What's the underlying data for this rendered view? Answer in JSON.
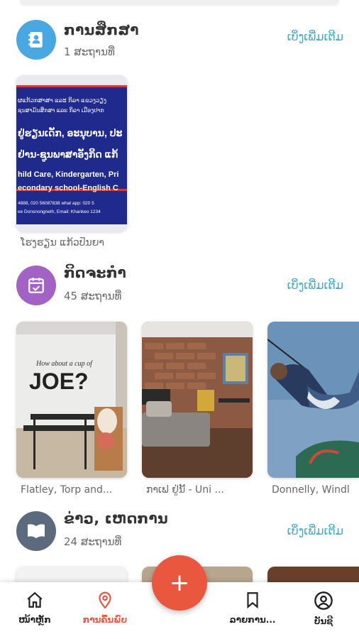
{
  "sections": [
    {
      "title": "ການສຶກສາ",
      "count": "1 ສະຖານທີ່",
      "see_more": "ເບິ່ງເພີ່ມເຕີມ",
      "icon": "contact-book-icon",
      "color": "#4aa8e0",
      "cards": [
        {
          "caption": "ໂຮງຮຽນ ແກ້ວປັນຍາ",
          "sign_lines": [
            "ຜແກ້ວກສາສາ ແລະ ກິລາ ແຂວງວຽງ",
            "ຊນສາມັນສຶກສາ ແລະ ກິລາ ເມືອງປາກ",
            "ຢູ່ຮຽນເດັກ, ອະນຸບານ, ປະ",
            "ຢ່ານ-ຊູນພາສາອັງກິດ ແກ້",
            "hild Care, Kindergarten, Pri",
            "econdary school-English C",
            "4888, 020 56087838 what app: 020 5",
            "ee Donsnongneth, Email: Khankeo 1234"
          ]
        }
      ]
    },
    {
      "title": "ກິດຈະກຳ",
      "count": "45 ສະຖານທີ່",
      "see_more": "ເບິ່ງເພີ່ມເຕີມ",
      "icon": "calendar-check-icon",
      "color": "#a263c4",
      "cards": [
        {
          "caption": "Flatley, Torp and...",
          "wall_line1": "How about a cup of",
          "wall_line2": "JOE?"
        },
        {
          "caption": "ກາເຟ ຢູ່ນີ້ - Uni ..."
        },
        {
          "caption": "Donnelly, Windl"
        }
      ]
    },
    {
      "title": "ຂ່າວ, ເຫດການ",
      "count": "24 ສະຖານທີ່",
      "see_more": "ເບິ່ງເພີ່ມເຕີມ",
      "icon": "book-open-icon",
      "color": "#5b6b7d"
    }
  ],
  "nav": {
    "home": "ໜ້າຫຼັກ",
    "explore": "ການຄົ້ນພົບ",
    "saved": "ລາຍການ...",
    "account": "ບັນຊີ"
  },
  "fab_label": "+",
  "colors": {
    "accent": "#e9573f",
    "link": "#4aa3bf"
  }
}
